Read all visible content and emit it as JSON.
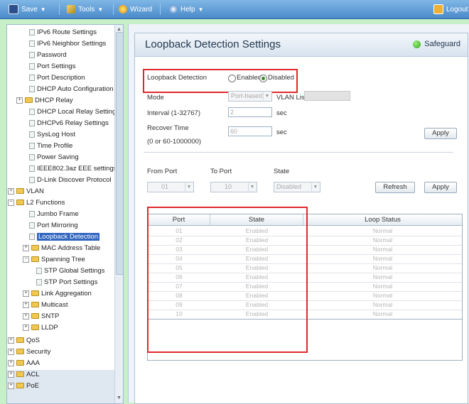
{
  "toolbar": {
    "save": "Save",
    "tools": "Tools",
    "wizard": "Wizard",
    "help": "Help",
    "logout": "Logout"
  },
  "nav": {
    "items": [
      {
        "label": "IPv6 Route Settings",
        "type": "page"
      },
      {
        "label": "IPv6 Neighbor Settings",
        "type": "page"
      },
      {
        "label": "Password",
        "type": "page"
      },
      {
        "label": "Port Settings",
        "type": "page"
      },
      {
        "label": "Port Description",
        "type": "page"
      },
      {
        "label": "DHCP Auto Configuration",
        "type": "page"
      },
      {
        "label": "DHCP Relay",
        "type": "folder"
      },
      {
        "label": "DHCP Local Relay Settings",
        "type": "page"
      },
      {
        "label": "DHCPv6 Relay Settings",
        "type": "page"
      },
      {
        "label": "SysLog Host",
        "type": "page"
      },
      {
        "label": "Time Profile",
        "type": "page"
      },
      {
        "label": "Power Saving",
        "type": "page"
      },
      {
        "label": "IEEE802.3az EEE settings",
        "type": "page"
      },
      {
        "label": "D-Link Discover Protocol",
        "type": "page"
      },
      {
        "label": "VLAN",
        "type": "folder"
      },
      {
        "label": "L2 Functions",
        "type": "folder"
      },
      {
        "label": "Jumbo Frame",
        "type": "page"
      },
      {
        "label": "Port Mirroring",
        "type": "page"
      },
      {
        "label": "Loopback Detection",
        "type": "page",
        "selected": true
      },
      {
        "label": "MAC Address Table",
        "type": "folder"
      },
      {
        "label": "Spanning Tree",
        "type": "folder"
      },
      {
        "label": "STP Global Settings",
        "type": "page"
      },
      {
        "label": "STP Port Settings",
        "type": "page"
      },
      {
        "label": "Link Aggregation",
        "type": "folder"
      },
      {
        "label": "Multicast",
        "type": "folder"
      },
      {
        "label": "SNTP",
        "type": "folder"
      },
      {
        "label": "LLDP",
        "type": "folder"
      },
      {
        "label": "QoS",
        "type": "folder"
      },
      {
        "label": "Security",
        "type": "folder"
      },
      {
        "label": "AAA",
        "type": "folder"
      },
      {
        "label": "ACL",
        "type": "folder"
      },
      {
        "label": "PoE",
        "type": "folder"
      }
    ]
  },
  "panel": {
    "title": "Loopback Detection Settings",
    "safeguard": "Safeguard",
    "loopback_label": "Loopback Detection",
    "enabled": "Enabled",
    "disabled": "Disabled",
    "mode_label": "Mode",
    "mode_value": "Port-based",
    "vlan_list_label": "VLAN List",
    "interval_label": "Interval (1-32767)",
    "interval_value": "2",
    "interval_unit": "sec",
    "recover_label": "Recover Time",
    "recover_range": "(0 or 60-1000000)",
    "recover_value": "60",
    "recover_unit": "sec",
    "apply": "Apply",
    "from_port_label": "From Port",
    "to_port_label": "To Port",
    "state_label": "State",
    "from_port_value": "01",
    "to_port_value": "10",
    "state_value": "Disabled",
    "refresh": "Refresh",
    "apply2": "Apply"
  },
  "table": {
    "headers": [
      "Port",
      "State",
      "Loop Status"
    ],
    "rows": [
      [
        "01",
        "Enabled",
        "Normal"
      ],
      [
        "02",
        "Enabled",
        "Normal"
      ],
      [
        "03",
        "Enabled",
        "Normal"
      ],
      [
        "04",
        "Enabled",
        "Normal"
      ],
      [
        "05",
        "Enabled",
        "Normal"
      ],
      [
        "06",
        "Enabled",
        "Normal"
      ],
      [
        "07",
        "Enabled",
        "Normal"
      ],
      [
        "08",
        "Enabled",
        "Normal"
      ],
      [
        "09",
        "Enabled",
        "Normal"
      ],
      [
        "10",
        "Enabled",
        "Normal"
      ]
    ]
  },
  "colors": {
    "background": "#c8f0c8",
    "toolbar": "#4a8ac9",
    "selection": "#3166c0",
    "highlight_box": "#e0282c"
  }
}
